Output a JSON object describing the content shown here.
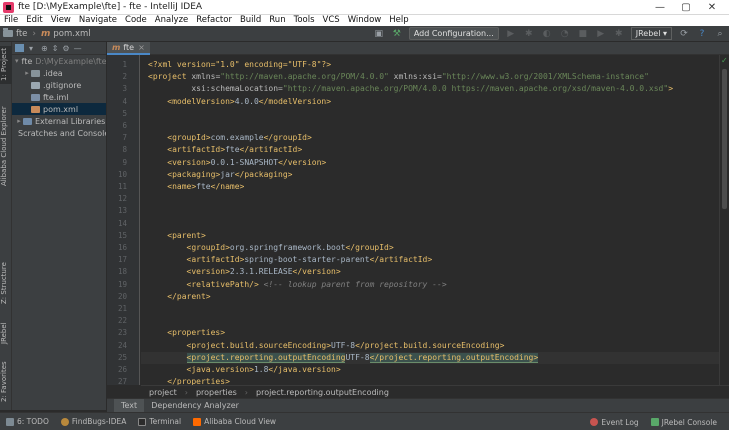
{
  "window": {
    "title": "fte [D:\\MyExample\\fte] - fte - IntelliJ IDEA",
    "controls": [
      "—",
      "▢",
      "✕"
    ]
  },
  "menu": [
    "File",
    "Edit",
    "View",
    "Navigate",
    "Code",
    "Analyze",
    "Refactor",
    "Build",
    "Run",
    "Tools",
    "VCS",
    "Window",
    "Help"
  ],
  "nav": {
    "project": "fte",
    "file": "pom.xml",
    "file_prefix": "m",
    "add_configuration": "Add Configuration...",
    "jrebel": "JRebel ▾"
  },
  "left_stripe": {
    "project_tab": "1: Project",
    "alibaba_tab": "Alibaba Cloud Explorer",
    "structure_tab": "Z: Structure",
    "jrebel_tab": "JRebel",
    "favorites_tab": "2: Favorites"
  },
  "project_panel": {
    "header_icon": "▾",
    "tree": [
      {
        "label": "fte",
        "detail": "D:\\MyExample\\fte",
        "depth": 0,
        "arrow": "▾",
        "kind": "folder"
      },
      {
        "label": ".idea",
        "detail": "",
        "depth": 1,
        "arrow": "▸",
        "kind": "folder"
      },
      {
        "label": ".gitignore",
        "detail": "",
        "depth": 1,
        "arrow": "",
        "kind": "file"
      },
      {
        "label": "fte.iml",
        "detail": "",
        "depth": 1,
        "arrow": "",
        "kind": "iml"
      },
      {
        "label": "pom.xml",
        "detail": "",
        "depth": 1,
        "arrow": "",
        "kind": "maven"
      },
      {
        "label": "External Libraries",
        "detail": "",
        "depth": 0,
        "arrow": "▸",
        "kind": "lib"
      },
      {
        "label": "Scratches and Consoles",
        "detail": "",
        "depth": 0,
        "arrow": "",
        "kind": "scratch"
      }
    ]
  },
  "editor": {
    "tab_label": "fte",
    "tab_close": "×",
    "line_numbers": [
      "1",
      "2",
      "3",
      "4",
      "5",
      "6",
      "7",
      "8",
      "9",
      "10",
      "11",
      "12",
      "13",
      "14",
      "15",
      "16",
      "17",
      "18",
      "19",
      "20",
      "21",
      "22",
      "23",
      "24",
      "25",
      "26",
      "27"
    ],
    "current_line": 25,
    "lines": [
      [
        [
          "pi",
          "<?xml version=\"1.0\" encoding=\"UTF-8\"?>"
        ]
      ],
      [
        [
          "t",
          "<project "
        ],
        [
          "a",
          "xmlns="
        ],
        [
          "v",
          "\"http://maven.apache.org/POM/4.0.0\" "
        ],
        [
          "a",
          "xmlns:xsi="
        ],
        [
          "v",
          "\"http://www.w3.org/2001/XMLSchema-instance\""
        ]
      ],
      [
        [
          "x",
          "         "
        ],
        [
          "a",
          "xsi:schemaLocation="
        ],
        [
          "v",
          "\"http://maven.apache.org/POM/4.0.0 https://maven.apache.org/xsd/maven-4.0.0.xsd\""
        ],
        [
          "t",
          ">"
        ]
      ],
      [
        [
          "x",
          "    "
        ],
        [
          "t",
          "<modelVersion>"
        ],
        [
          "x",
          "4.0.0"
        ],
        [
          "t",
          "</modelVersion>"
        ]
      ],
      [],
      [],
      [
        [
          "x",
          "    "
        ],
        [
          "t",
          "<groupId>"
        ],
        [
          "x",
          "com.example"
        ],
        [
          "t",
          "</groupId>"
        ]
      ],
      [
        [
          "x",
          "    "
        ],
        [
          "t",
          "<artifactId>"
        ],
        [
          "x",
          "fte"
        ],
        [
          "t",
          "</artifactId>"
        ]
      ],
      [
        [
          "x",
          "    "
        ],
        [
          "t",
          "<version>"
        ],
        [
          "x",
          "0.0.1-SNAPSHOT"
        ],
        [
          "t",
          "</version>"
        ]
      ],
      [
        [
          "x",
          "    "
        ],
        [
          "t",
          "<packaging>"
        ],
        [
          "x",
          "jar"
        ],
        [
          "t",
          "</packaging>"
        ]
      ],
      [
        [
          "x",
          "    "
        ],
        [
          "t",
          "<name>"
        ],
        [
          "x",
          "fte"
        ],
        [
          "t",
          "</name>"
        ]
      ],
      [],
      [],
      [],
      [
        [
          "x",
          "    "
        ],
        [
          "t",
          "<parent>"
        ]
      ],
      [
        [
          "x",
          "        "
        ],
        [
          "t",
          "<groupId>"
        ],
        [
          "x",
          "org.springframework.boot"
        ],
        [
          "t",
          "</groupId>"
        ]
      ],
      [
        [
          "x",
          "        "
        ],
        [
          "t",
          "<artifactId>"
        ],
        [
          "x",
          "spring-boot-starter-parent"
        ],
        [
          "t",
          "</artifactId>"
        ]
      ],
      [
        [
          "x",
          "        "
        ],
        [
          "t",
          "<version>"
        ],
        [
          "x",
          "2.3.1.RELEASE"
        ],
        [
          "t",
          "</version>"
        ]
      ],
      [
        [
          "x",
          "        "
        ],
        [
          "t",
          "<relativePath/>"
        ],
        [
          "x",
          " "
        ],
        [
          "c",
          "<!-- lookup parent from repository -->"
        ]
      ],
      [
        [
          "x",
          "    "
        ],
        [
          "t",
          "</parent>"
        ]
      ],
      [],
      [],
      [
        [
          "x",
          "    "
        ],
        [
          "t",
          "<properties>"
        ]
      ],
      [
        [
          "x",
          "        "
        ],
        [
          "t",
          "<project.build.sourceEncoding>"
        ],
        [
          "x",
          "UTF-8"
        ],
        [
          "t",
          "</project.build.sourceEncoding>"
        ]
      ],
      [
        [
          "x",
          "        "
        ],
        [
          "h",
          "<project.reporting.outputEncoding"
        ],
        [
          "x",
          "UTF-8"
        ],
        [
          "h",
          "</project.reporting.outputEncoding>"
        ]
      ],
      [
        [
          "x",
          "        "
        ],
        [
          "t",
          "<java.version>"
        ],
        [
          "x",
          "1.8"
        ],
        [
          "t",
          "</java.version>"
        ]
      ],
      [
        [
          "x",
          "    "
        ],
        [
          "t",
          "</properties>"
        ]
      ]
    ],
    "check_mark": "✓",
    "breadcrumbs": [
      "project",
      "properties",
      "project.reporting.outputEncoding"
    ],
    "bottom_tabs": [
      "Text",
      "Dependency Analyzer"
    ]
  },
  "bottom_bar": {
    "left": [
      "6: TODO",
      "FindBugs-IDEA",
      "Terminal",
      "Alibaba Cloud View"
    ],
    "right": [
      "Event Log",
      "JRebel Console"
    ]
  },
  "colors": {
    "tag": "#e8bf6a",
    "attr_value": "#6a8759",
    "comment": "#808080",
    "selection": "#0d293e"
  }
}
